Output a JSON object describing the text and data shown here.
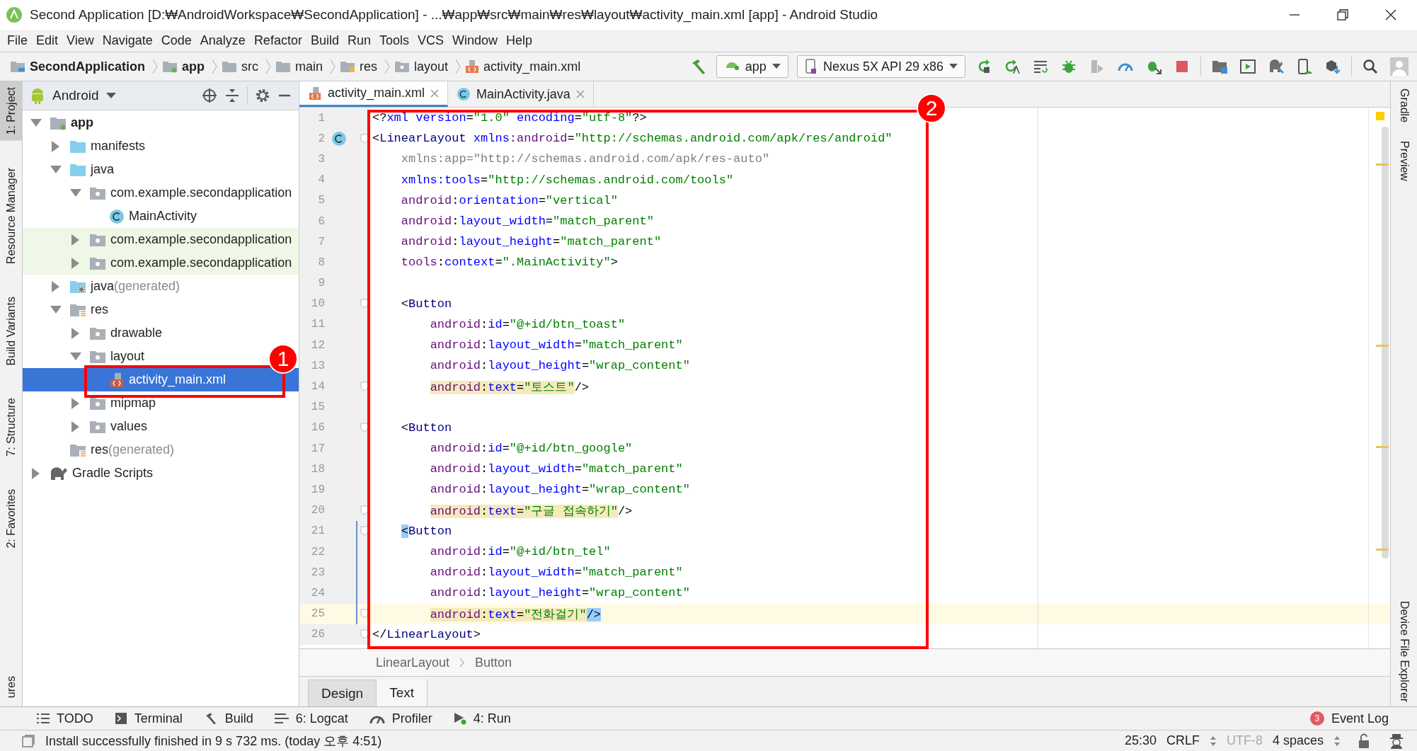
{
  "window": {
    "title": "Second Application [D:₩AndroidWorkspace₩SecondApplication] - ...₩app₩src₩main₩res₩layout₩activity_main.xml [app] - Android Studio"
  },
  "menu": [
    "File",
    "Edit",
    "View",
    "Navigate",
    "Code",
    "Analyze",
    "Refactor",
    "Build",
    "Run",
    "Tools",
    "VCS",
    "Window",
    "Help"
  ],
  "breadcrumb": [
    {
      "label": "SecondApplication",
      "kind": "project"
    },
    {
      "label": "app",
      "kind": "module"
    },
    {
      "label": "src",
      "kind": "folder"
    },
    {
      "label": "main",
      "kind": "folder"
    },
    {
      "label": "res",
      "kind": "res"
    },
    {
      "label": "layout",
      "kind": "package"
    },
    {
      "label": "activity_main.xml",
      "kind": "xml"
    }
  ],
  "toolbar": {
    "config": "app",
    "device": "Nexus 5X API 29 x86"
  },
  "left_tabs": [
    {
      "label": "1: Project",
      "selected": true
    },
    {
      "label": "Resource Manager",
      "selected": false
    },
    {
      "label": "Build Variants",
      "selected": false
    },
    {
      "label": "7: Structure",
      "selected": false
    },
    {
      "label": "2: Favorites",
      "selected": false
    },
    {
      "label": "ures",
      "selected": false
    }
  ],
  "project": {
    "view": "Android",
    "tree": [
      {
        "label": "app",
        "kind": "module",
        "expanded": true,
        "selected": false,
        "test": false,
        "children": [
          {
            "label": "manifests",
            "kind": "folder",
            "expanded": false,
            "selected": false,
            "test": false
          },
          {
            "label": "java",
            "kind": "folder",
            "expanded": true,
            "selected": false,
            "test": false,
            "children": [
              {
                "label": "com.example.secondapplication",
                "kind": "package",
                "expanded": true,
                "selected": false,
                "test": false,
                "children": [
                  {
                    "label": "MainActivity",
                    "kind": "class",
                    "selected": false,
                    "test": false
                  }
                ]
              },
              {
                "label": "com.example.secondapplication",
                "kind": "package",
                "expanded": false,
                "selected": false,
                "test": true
              },
              {
                "label": "com.example.secondapplication",
                "kind": "package",
                "expanded": false,
                "selected": false,
                "test": true
              }
            ]
          },
          {
            "label": "java",
            "suffix": "(generated)",
            "kind": "generated",
            "expanded": false,
            "selected": false,
            "test": false
          },
          {
            "label": "res",
            "kind": "res",
            "expanded": true,
            "selected": false,
            "test": false,
            "children": [
              {
                "label": "drawable",
                "kind": "package",
                "expanded": false,
                "selected": false,
                "test": false
              },
              {
                "label": "layout",
                "kind": "package",
                "expanded": true,
                "selected": false,
                "test": false,
                "children": [
                  {
                    "label": "activity_main.xml",
                    "kind": "xml",
                    "selected": true,
                    "test": false
                  }
                ]
              },
              {
                "label": "mipmap",
                "kind": "package",
                "expanded": false,
                "selected": false,
                "test": false
              },
              {
                "label": "values",
                "kind": "package",
                "expanded": false,
                "selected": false,
                "test": false
              }
            ]
          },
          {
            "label": "res",
            "suffix": "(generated)",
            "kind": "res",
            "selected": false,
            "test": false
          }
        ]
      },
      {
        "label": "Gradle Scripts",
        "kind": "gradle",
        "expanded": false,
        "selected": false,
        "test": false
      }
    ]
  },
  "editor_tabs": [
    {
      "label": "activity_main.xml",
      "kind": "xml",
      "selected": true
    },
    {
      "label": "MainActivity.java",
      "kind": "class",
      "selected": false
    }
  ],
  "code": {
    "lines": [
      {
        "n": "1",
        "fold": false,
        "changed": false,
        "current": false,
        "tokens": [
          {
            "kind": "punct",
            "t": "<?"
          },
          {
            "kind": "attr",
            "t": "xml version"
          },
          {
            "kind": "punct",
            "t": "="
          },
          {
            "kind": "value",
            "t": "\"1.0\""
          },
          {
            "kind": "attr",
            "t": " encoding"
          },
          {
            "kind": "punct",
            "t": "="
          },
          {
            "kind": "value",
            "t": "\"utf-8\""
          },
          {
            "kind": "punct",
            "t": "?>"
          }
        ]
      },
      {
        "n": "2",
        "gutter": {
          "kind": "class"
        },
        "fold": true,
        "changed": false,
        "current": false,
        "tokens": [
          {
            "kind": "punct",
            "t": "<"
          },
          {
            "kind": "tag",
            "t": "LinearLayout"
          },
          {
            "kind": "attr",
            "t": " xmlns"
          },
          {
            "kind": "ns",
            "t": ":android"
          },
          {
            "kind": "punct",
            "t": "="
          },
          {
            "kind": "value",
            "t": "\"http://schemas.android.com/apk/res/android\""
          }
        ]
      },
      {
        "n": "3",
        "fold": false,
        "changed": false,
        "current": false,
        "tokens": [
          {
            "kind": "dim",
            "t": "    xmlns:app=\"http://schemas.android.com/apk/res-auto\""
          }
        ]
      },
      {
        "n": "4",
        "fold": false,
        "changed": false,
        "current": false,
        "tokens": [
          {
            "kind": "attr",
            "t": "    xmlns:tools"
          },
          {
            "kind": "punct",
            "t": "="
          },
          {
            "kind": "value",
            "t": "\"http://schemas.android.com/tools\""
          }
        ]
      },
      {
        "n": "5",
        "fold": false,
        "changed": false,
        "current": false,
        "tokens": [
          {
            "kind": "ns",
            "t": "    android"
          },
          {
            "kind": "punct",
            "t": ":"
          },
          {
            "kind": "attr",
            "t": "orientation"
          },
          {
            "kind": "punct",
            "t": "="
          },
          {
            "kind": "value",
            "t": "\"vertical\""
          }
        ]
      },
      {
        "n": "6",
        "fold": false,
        "changed": false,
        "current": false,
        "tokens": [
          {
            "kind": "ns",
            "t": "    android"
          },
          {
            "kind": "punct",
            "t": ":"
          },
          {
            "kind": "attr",
            "t": "layout_width"
          },
          {
            "kind": "punct",
            "t": "="
          },
          {
            "kind": "value",
            "t": "\"match_parent\""
          }
        ]
      },
      {
        "n": "7",
        "fold": false,
        "changed": false,
        "current": false,
        "tokens": [
          {
            "kind": "ns",
            "t": "    android"
          },
          {
            "kind": "punct",
            "t": ":"
          },
          {
            "kind": "attr",
            "t": "layout_height"
          },
          {
            "kind": "punct",
            "t": "="
          },
          {
            "kind": "value",
            "t": "\"match_parent\""
          }
        ]
      },
      {
        "n": "8",
        "fold": false,
        "changed": false,
        "current": false,
        "tokens": [
          {
            "kind": "ns",
            "t": "    tools"
          },
          {
            "kind": "punct",
            "t": ":"
          },
          {
            "kind": "attr",
            "t": "context"
          },
          {
            "kind": "punct",
            "t": "="
          },
          {
            "kind": "value",
            "t": "\".MainActivity\""
          },
          {
            "kind": "punct",
            "t": ">"
          }
        ]
      },
      {
        "n": "9",
        "fold": false,
        "changed": false,
        "current": false
      },
      {
        "n": "10",
        "fold": true,
        "changed": false,
        "current": false,
        "tokens": [
          {
            "kind": "punct",
            "t": "    <"
          },
          {
            "kind": "tag",
            "t": "Button"
          }
        ]
      },
      {
        "n": "11",
        "fold": false,
        "changed": false,
        "current": false,
        "tokens": [
          {
            "kind": "ns",
            "t": "        android"
          },
          {
            "kind": "punct",
            "t": ":"
          },
          {
            "kind": "attr",
            "t": "id"
          },
          {
            "kind": "punct",
            "t": "="
          },
          {
            "kind": "value",
            "t": "\"@+id/btn_toast\""
          }
        ]
      },
      {
        "n": "12",
        "fold": false,
        "changed": false,
        "current": false,
        "tokens": [
          {
            "kind": "ns",
            "t": "        android"
          },
          {
            "kind": "punct",
            "t": ":"
          },
          {
            "kind": "attr",
            "t": "layout_width"
          },
          {
            "kind": "punct",
            "t": "="
          },
          {
            "kind": "value",
            "t": "\"match_parent\""
          }
        ]
      },
      {
        "n": "13",
        "fold": false,
        "changed": false,
        "current": false,
        "tokens": [
          {
            "kind": "ns",
            "t": "        android"
          },
          {
            "kind": "punct",
            "t": ":"
          },
          {
            "kind": "attr",
            "t": "layout_height"
          },
          {
            "kind": "punct",
            "t": "="
          },
          {
            "kind": "value",
            "t": "\"wrap_content\""
          }
        ]
      },
      {
        "n": "14",
        "fold": true,
        "changed": false,
        "current": false,
        "tokens": [
          {
            "kind": "warning",
            "tokens": [
              {
                "kind": "ns",
                "t": "        android"
              },
              {
                "kind": "punct",
                "t": ":"
              },
              {
                "kind": "attr",
                "t": "text"
              },
              {
                "kind": "punct",
                "t": "="
              },
              {
                "kind": "value",
                "t": "\"토스트\""
              }
            ]
          },
          {
            "kind": "punct",
            "t": "/>"
          }
        ]
      },
      {
        "n": "15",
        "fold": false,
        "changed": false,
        "current": false
      },
      {
        "n": "16",
        "fold": true,
        "changed": false,
        "current": false,
        "tokens": [
          {
            "kind": "punct",
            "t": "    <"
          },
          {
            "kind": "tag",
            "t": "Button"
          }
        ]
      },
      {
        "n": "17",
        "fold": false,
        "changed": false,
        "current": false,
        "tokens": [
          {
            "kind": "ns",
            "t": "        android"
          },
          {
            "kind": "punct",
            "t": ":"
          },
          {
            "kind": "attr",
            "t": "id"
          },
          {
            "kind": "punct",
            "t": "="
          },
          {
            "kind": "value",
            "t": "\"@+id/btn_google\""
          }
        ]
      },
      {
        "n": "18",
        "fold": false,
        "changed": false,
        "current": false,
        "tokens": [
          {
            "kind": "ns",
            "t": "        android"
          },
          {
            "kind": "punct",
            "t": ":"
          },
          {
            "kind": "attr",
            "t": "layout_width"
          },
          {
            "kind": "punct",
            "t": "="
          },
          {
            "kind": "value",
            "t": "\"match_parent\""
          }
        ]
      },
      {
        "n": "19",
        "fold": false,
        "changed": false,
        "current": false,
        "tokens": [
          {
            "kind": "ns",
            "t": "        android"
          },
          {
            "kind": "punct",
            "t": ":"
          },
          {
            "kind": "attr",
            "t": "layout_height"
          },
          {
            "kind": "punct",
            "t": "="
          },
          {
            "kind": "value",
            "t": "\"wrap_content\""
          }
        ]
      },
      {
        "n": "20",
        "fold": true,
        "changed": false,
        "current": false,
        "tokens": [
          {
            "kind": "warning",
            "tokens": [
              {
                "kind": "ns",
                "t": "        android"
              },
              {
                "kind": "punct",
                "t": ":"
              },
              {
                "kind": "attr",
                "t": "text"
              },
              {
                "kind": "punct",
                "t": "="
              },
              {
                "kind": "value",
                "t": "\"구글 접속하기\""
              }
            ]
          },
          {
            "kind": "punct",
            "t": "/>"
          }
        ]
      },
      {
        "n": "21",
        "fold": true,
        "changed": true,
        "current": false,
        "tokens": [
          {
            "kind": "match",
            "tokens": [
              {
                "kind": "punct",
                "t": "    <"
              }
            ]
          },
          {
            "kind": "tag",
            "t": "Button"
          }
        ]
      },
      {
        "n": "22",
        "fold": false,
        "changed": true,
        "current": false,
        "tokens": [
          {
            "kind": "ns",
            "t": "        android"
          },
          {
            "kind": "punct",
            "t": ":"
          },
          {
            "kind": "attr",
            "t": "id"
          },
          {
            "kind": "punct",
            "t": "="
          },
          {
            "kind": "value",
            "t": "\"@+id/btn_tel\""
          }
        ]
      },
      {
        "n": "23",
        "fold": false,
        "changed": true,
        "current": false,
        "tokens": [
          {
            "kind": "ns",
            "t": "        android"
          },
          {
            "kind": "punct",
            "t": ":"
          },
          {
            "kind": "attr",
            "t": "layout_width"
          },
          {
            "kind": "punct",
            "t": "="
          },
          {
            "kind": "value",
            "t": "\"match_parent\""
          }
        ]
      },
      {
        "n": "24",
        "fold": false,
        "changed": true,
        "current": false,
        "tokens": [
          {
            "kind": "ns",
            "t": "        android"
          },
          {
            "kind": "punct",
            "t": ":"
          },
          {
            "kind": "attr",
            "t": "layout_height"
          },
          {
            "kind": "punct",
            "t": "="
          },
          {
            "kind": "value",
            "t": "\"wrap_content\""
          }
        ]
      },
      {
        "n": "25",
        "fold": true,
        "changed": true,
        "current": true,
        "tokens": [
          {
            "kind": "warning",
            "tokens": [
              {
                "kind": "ns",
                "t": "        android"
              },
              {
                "kind": "punct",
                "t": ":"
              },
              {
                "kind": "attr",
                "t": "text"
              },
              {
                "kind": "punct",
                "t": "="
              },
              {
                "kind": "value",
                "t": "\"전화걸기\""
              }
            ]
          },
          {
            "kind": "match",
            "tokens": [
              {
                "kind": "punct",
                "t": "/>"
              }
            ]
          }
        ]
      },
      {
        "n": "26",
        "fold": true,
        "changed": false,
        "current": false,
        "tokens": [
          {
            "kind": "punct",
            "t": "</"
          },
          {
            "kind": "tag",
            "t": "LinearLayout"
          },
          {
            "kind": "punct",
            "t": ">"
          }
        ]
      }
    ]
  },
  "path": [
    "LinearLayout",
    "Button"
  ],
  "view_tabs": [
    {
      "label": "Design",
      "selected": false
    },
    {
      "label": "Text",
      "selected": true
    }
  ],
  "right_tabs": [
    "Gradle",
    "Preview",
    "Device File Explorer"
  ],
  "tool_windows": [
    {
      "label": "TODO",
      "kind": "todo"
    },
    {
      "label": "Terminal",
      "kind": "terminal"
    },
    {
      "label": "Build",
      "kind": "build"
    },
    {
      "label": "6: Logcat",
      "kind": "logcat"
    },
    {
      "label": "Profiler",
      "kind": "profiler"
    },
    {
      "label": "4: Run",
      "kind": "run"
    }
  ],
  "event_log": {
    "count": "3",
    "label": "Event Log"
  },
  "status": {
    "message": "Install successfully finished in 9 s 732 ms. (today 오후 4:51)",
    "position": "25:30",
    "line_separator": "CRLF",
    "encoding": "UTF-8",
    "encoding_disabled": true,
    "indent": "4 spaces"
  },
  "annotations": [
    {
      "number": "1",
      "kind": "tree"
    },
    {
      "number": "2",
      "kind": "code"
    }
  ]
}
